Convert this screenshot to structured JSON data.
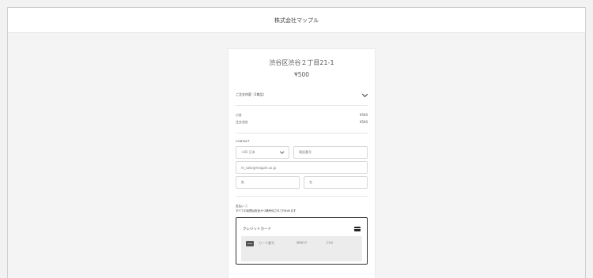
{
  "header": {
    "title": "株式会社マップル"
  },
  "store": {
    "name": "渋谷区渋谷２丁目21-1",
    "price": "¥500"
  },
  "order": {
    "summary_label": "ご注文内容（1商品）"
  },
  "summary": {
    "subtotal_label": "小計",
    "subtotal_value": "¥500",
    "total_label": "注文合計",
    "total_value": "¥500"
  },
  "contact": {
    "title": "CONTACT",
    "country_value": "+81 日本",
    "phone_placeholder": "電話番号",
    "email_value": "m_sato@mapple.co.jp",
    "last_name_placeholder": "姓",
    "first_name_placeholder": "名"
  },
  "payment": {
    "title": "支払い ⓘ",
    "note": "すべての処理は安全かつ暗号化されて行われます",
    "method_label": "クレジットカード",
    "card_number_placeholder": "カード番号",
    "expiry_placeholder": "MM/YY",
    "cvv_placeholder": "CVV"
  },
  "icons": {
    "chevron": "chevron-down-icon",
    "caret": "caret-down-icon",
    "card": "credit-card-icon"
  }
}
